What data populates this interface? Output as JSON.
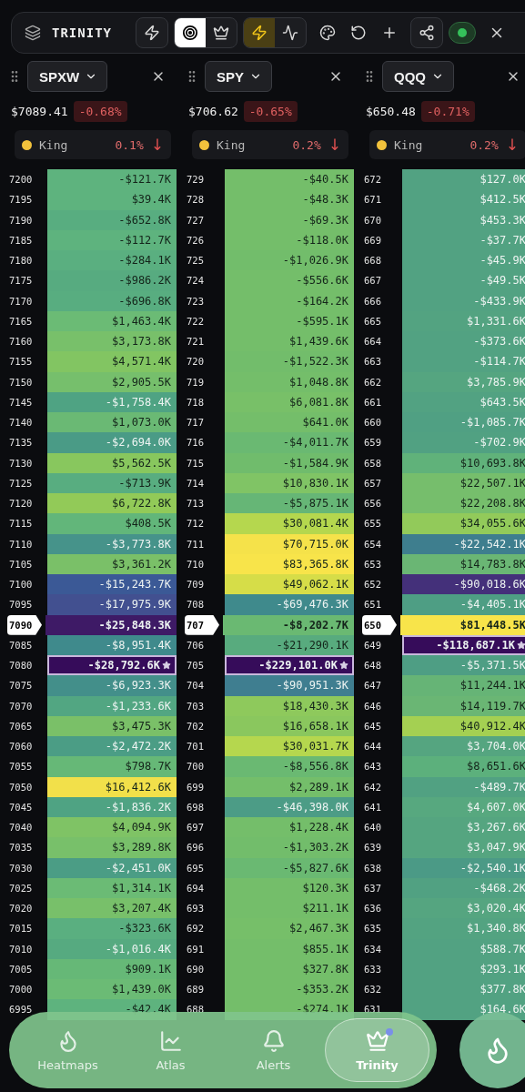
{
  "toolbar": {
    "title": "TRINITY",
    "groups": [
      {
        "boxed": true,
        "buttons": [
          {
            "kind": "bolt",
            "selected": false
          }
        ]
      },
      {
        "boxed": true,
        "buttons": [
          {
            "kind": "target",
            "selected": true
          },
          {
            "kind": "crown",
            "selected": false
          }
        ]
      },
      {
        "boxed": true,
        "buttons": [
          {
            "kind": "bolt",
            "selected": true
          },
          {
            "kind": "pulse",
            "selected": false
          }
        ]
      },
      {
        "boxed": false,
        "buttons": [
          {
            "kind": "palette",
            "selected": false
          },
          {
            "kind": "replay",
            "selected": false
          },
          {
            "kind": "plus",
            "selected": false
          }
        ]
      },
      {
        "boxed": true,
        "buttons": [
          {
            "kind": "share",
            "selected": false
          }
        ]
      }
    ],
    "live_toggle": {
      "on": true
    }
  },
  "columns": [
    {
      "ticker": "SPXW",
      "price": "$7089.41",
      "change": "-0.68%",
      "king": {
        "label": "King",
        "pct": "0.1%",
        "arrow": "↓"
      },
      "rows": [
        {
          "strike": "7200",
          "value": "-$121.7K",
          "color": "#5eb37e",
          "current": false,
          "star": false
        },
        {
          "strike": "7195",
          "value": "$39.4K",
          "color": "#5eb37e",
          "current": false,
          "star": false
        },
        {
          "strike": "7190",
          "value": "-$652.8K",
          "color": "#58ad80",
          "current": false,
          "star": false
        },
        {
          "strike": "7185",
          "value": "-$112.7K",
          "color": "#5eb37e",
          "current": false,
          "star": false
        },
        {
          "strike": "7180",
          "value": "-$284.1K",
          "color": "#5aaf80",
          "current": false,
          "star": false
        },
        {
          "strike": "7175",
          "value": "-$986.2K",
          "color": "#57ab80",
          "current": false,
          "star": false
        },
        {
          "strike": "7170",
          "value": "-$696.8K",
          "color": "#58ad80",
          "current": false,
          "star": false
        },
        {
          "strike": "7165",
          "value": "$1,463.4K",
          "color": "#6bbb75",
          "current": false,
          "star": false
        },
        {
          "strike": "7160",
          "value": "$3,173.8K",
          "color": "#78c06a",
          "current": false,
          "star": false
        },
        {
          "strike": "7155",
          "value": "$4,571.4K",
          "color": "#82c562",
          "current": false,
          "star": false
        },
        {
          "strike": "7150",
          "value": "$2,905.5K",
          "color": "#76bf6c",
          "current": false,
          "star": false
        },
        {
          "strike": "7145",
          "value": "-$1,758.4K",
          "color": "#4fa383",
          "current": false,
          "star": false
        },
        {
          "strike": "7140",
          "value": "$1,073.0K",
          "color": "#6ab974",
          "current": false,
          "star": false
        },
        {
          "strike": "7135",
          "value": "-$2,694.0K",
          "color": "#4a9b86",
          "current": false,
          "star": false
        },
        {
          "strike": "7130",
          "value": "$5,562.5K",
          "color": "#88c75e",
          "current": false,
          "star": false
        },
        {
          "strike": "7125",
          "value": "-$713.9K",
          "color": "#58ad80",
          "current": false,
          "star": false
        },
        {
          "strike": "7120",
          "value": "$6,722.8K",
          "color": "#92ca58",
          "current": false,
          "star": false
        },
        {
          "strike": "7115",
          "value": "$408.5K",
          "color": "#62b67a",
          "current": false,
          "star": false
        },
        {
          "strike": "7110",
          "value": "-$3,773.8K",
          "color": "#46938a",
          "current": false,
          "star": false
        },
        {
          "strike": "7105",
          "value": "$3,361.2K",
          "color": "#7ac068",
          "current": false,
          "star": false
        },
        {
          "strike": "7100",
          "value": "-$15,243.7K",
          "color": "#3b5996",
          "current": false,
          "star": false
        },
        {
          "strike": "7095",
          "value": "-$17,975.9K",
          "color": "#425090",
          "current": false,
          "star": false
        },
        {
          "strike": "7090",
          "value": "-$25,848.3K",
          "color": "#3e1a66",
          "current": true,
          "star": false
        },
        {
          "strike": "7085",
          "value": "-$8,951.4K",
          "color": "#3f8a8c",
          "current": false,
          "star": false
        },
        {
          "strike": "7080",
          "value": "-$28,792.6K",
          "color": "#360c5a",
          "current": false,
          "star": true
        },
        {
          "strike": "7075",
          "value": "-$6,923.3K",
          "color": "#438f8a",
          "current": false,
          "star": false
        },
        {
          "strike": "7070",
          "value": "-$1,233.6K",
          "color": "#52a682",
          "current": false,
          "star": false
        },
        {
          "strike": "7065",
          "value": "$3,475.3K",
          "color": "#7ac068",
          "current": false,
          "star": false
        },
        {
          "strike": "7060",
          "value": "-$2,472.2K",
          "color": "#4b9d85",
          "current": false,
          "star": false
        },
        {
          "strike": "7055",
          "value": "$798.7K",
          "color": "#66b877",
          "current": false,
          "star": false
        },
        {
          "strike": "7050",
          "value": "$16,412.6K",
          "color": "#f2e04a",
          "current": false,
          "star": false
        },
        {
          "strike": "7045",
          "value": "-$1,836.2K",
          "color": "#4fa383",
          "current": false,
          "star": false
        },
        {
          "strike": "7040",
          "value": "$4,094.9K",
          "color": "#7fc365",
          "current": false,
          "star": false
        },
        {
          "strike": "7035",
          "value": "$3,289.8K",
          "color": "#78c06a",
          "current": false,
          "star": false
        },
        {
          "strike": "7030",
          "value": "-$2,451.0K",
          "color": "#4b9d85",
          "current": false,
          "star": false
        },
        {
          "strike": "7025",
          "value": "$1,314.1K",
          "color": "#6bbb75",
          "current": false,
          "star": false
        },
        {
          "strike": "7020",
          "value": "$3,207.4K",
          "color": "#78c06a",
          "current": false,
          "star": false
        },
        {
          "strike": "7015",
          "value": "-$323.6K",
          "color": "#5aaf80",
          "current": false,
          "star": false
        },
        {
          "strike": "7010",
          "value": "-$1,016.4K",
          "color": "#56aa80",
          "current": false,
          "star": false
        },
        {
          "strike": "7005",
          "value": "$909.1K",
          "color": "#66b877",
          "current": false,
          "star": false
        },
        {
          "strike": "7000",
          "value": "$1,439.0K",
          "color": "#6bbb75",
          "current": false,
          "star": false
        },
        {
          "strike": "6995",
          "value": "-$42.4K",
          "color": "#5eb37e",
          "current": false,
          "star": false
        }
      ]
    },
    {
      "ticker": "SPY",
      "price": "$706.62",
      "change": "-0.65%",
      "king": {
        "label": "King",
        "pct": "0.2%",
        "arrow": "↓"
      },
      "rows": [
        {
          "strike": "729",
          "value": "-$40.5K",
          "color": "#74be6a",
          "current": false,
          "star": false
        },
        {
          "strike": "728",
          "value": "-$48.3K",
          "color": "#74be6a",
          "current": false,
          "star": false
        },
        {
          "strike": "727",
          "value": "-$69.3K",
          "color": "#74be6a",
          "current": false,
          "star": false
        },
        {
          "strike": "726",
          "value": "-$118.0K",
          "color": "#74be6a",
          "current": false,
          "star": false
        },
        {
          "strike": "725",
          "value": "-$1,026.9K",
          "color": "#72bd6b",
          "current": false,
          "star": false
        },
        {
          "strike": "724",
          "value": "-$556.6K",
          "color": "#74be6a",
          "current": false,
          "star": false
        },
        {
          "strike": "723",
          "value": "-$164.2K",
          "color": "#74be6a",
          "current": false,
          "star": false
        },
        {
          "strike": "722",
          "value": "-$595.1K",
          "color": "#74be6a",
          "current": false,
          "star": false
        },
        {
          "strike": "721",
          "value": "$1,439.6K",
          "color": "#74be6a",
          "current": false,
          "star": false
        },
        {
          "strike": "720",
          "value": "-$1,522.3K",
          "color": "#72bd6b",
          "current": false,
          "star": false
        },
        {
          "strike": "719",
          "value": "$1,048.8K",
          "color": "#74be6a",
          "current": false,
          "star": false
        },
        {
          "strike": "718",
          "value": "$6,081.8K",
          "color": "#78c068",
          "current": false,
          "star": false
        },
        {
          "strike": "717",
          "value": "$641.0K",
          "color": "#74be6a",
          "current": false,
          "star": false
        },
        {
          "strike": "716",
          "value": "-$4,011.7K",
          "color": "#6ab972",
          "current": false,
          "star": false
        },
        {
          "strike": "715",
          "value": "-$1,584.9K",
          "color": "#70bc6c",
          "current": false,
          "star": false
        },
        {
          "strike": "714",
          "value": "$10,830.1K",
          "color": "#80c465",
          "current": false,
          "star": false
        },
        {
          "strike": "713",
          "value": "-$5,875.1K",
          "color": "#66b676",
          "current": false,
          "star": false
        },
        {
          "strike": "712",
          "value": "$30,081.4K",
          "color": "#b5d74e",
          "current": false,
          "star": false
        },
        {
          "strike": "711",
          "value": "$70,715.0K",
          "color": "#f5e24a",
          "current": false,
          "star": false
        },
        {
          "strike": "710",
          "value": "$83,365.8K",
          "color": "#f8e44a",
          "current": false,
          "star": false
        },
        {
          "strike": "709",
          "value": "$49,062.1K",
          "color": "#d6dd48",
          "current": false,
          "star": false
        },
        {
          "strike": "708",
          "value": "-$69,476.3K",
          "color": "#3f8a8c",
          "current": false,
          "star": false
        },
        {
          "strike": "707",
          "value": "-$8,202.7K",
          "color": "#6ab972",
          "current": true,
          "star": false
        },
        {
          "strike": "706",
          "value": "-$21,290.1K",
          "color": "#58ab7e",
          "current": false,
          "star": false
        },
        {
          "strike": "705",
          "value": "-$229,101.0K",
          "color": "#360c5a",
          "current": false,
          "star": true
        },
        {
          "strike": "704",
          "value": "-$90,951.3K",
          "color": "#3f7e90",
          "current": false,
          "star": false
        },
        {
          "strike": "703",
          "value": "$18,430.3K",
          "color": "#8ec95c",
          "current": false,
          "star": false
        },
        {
          "strike": "702",
          "value": "$16,658.1K",
          "color": "#8ac75e",
          "current": false,
          "star": false
        },
        {
          "strike": "701",
          "value": "$30,031.7K",
          "color": "#b5d74e",
          "current": false,
          "star": false
        },
        {
          "strike": "700",
          "value": "-$8,556.8K",
          "color": "#6ab972",
          "current": false,
          "star": false
        },
        {
          "strike": "699",
          "value": "$2,289.1K",
          "color": "#74be6a",
          "current": false,
          "star": false
        },
        {
          "strike": "698",
          "value": "-$46,398.0K",
          "color": "#4c9c86",
          "current": false,
          "star": false
        },
        {
          "strike": "697",
          "value": "$1,228.4K",
          "color": "#74be6a",
          "current": false,
          "star": false
        },
        {
          "strike": "696",
          "value": "-$1,303.2K",
          "color": "#72bd6b",
          "current": false,
          "star": false
        },
        {
          "strike": "695",
          "value": "-$5,827.6K",
          "color": "#6ab972",
          "current": false,
          "star": false
        },
        {
          "strike": "694",
          "value": "$120.3K",
          "color": "#74be6a",
          "current": false,
          "star": false
        },
        {
          "strike": "693",
          "value": "$211.1K",
          "color": "#74be6a",
          "current": false,
          "star": false
        },
        {
          "strike": "692",
          "value": "$2,467.3K",
          "color": "#76bf69",
          "current": false,
          "star": false
        },
        {
          "strike": "691",
          "value": "$855.1K",
          "color": "#74be6a",
          "current": false,
          "star": false
        },
        {
          "strike": "690",
          "value": "$327.8K",
          "color": "#74be6a",
          "current": false,
          "star": false
        },
        {
          "strike": "689",
          "value": "-$353.2K",
          "color": "#74be6a",
          "current": false,
          "star": false
        },
        {
          "strike": "688",
          "value": "-$274.1K",
          "color": "#74be6a",
          "current": false,
          "star": false
        }
      ]
    },
    {
      "ticker": "QQQ",
      "price": "$650.48",
      "change": "-0.71%",
      "king": {
        "label": "King",
        "pct": "0.2%",
        "arrow": "↓"
      },
      "rows": [
        {
          "strike": "672",
          "value": "$127.0K",
          "color": "#52a282",
          "current": false,
          "star": false
        },
        {
          "strike": "671",
          "value": "$412.5K",
          "color": "#52a282",
          "current": false,
          "star": false
        },
        {
          "strike": "670",
          "value": "$453.3K",
          "color": "#52a282",
          "current": false,
          "star": false
        },
        {
          "strike": "669",
          "value": "-$37.7K",
          "color": "#52a282",
          "current": false,
          "star": false
        },
        {
          "strike": "668",
          "value": "-$45.9K",
          "color": "#52a282",
          "current": false,
          "star": false
        },
        {
          "strike": "667",
          "value": "-$49.5K",
          "color": "#52a282",
          "current": false,
          "star": false
        },
        {
          "strike": "666",
          "value": "-$433.9K",
          "color": "#52a282",
          "current": false,
          "star": false
        },
        {
          "strike": "665",
          "value": "$1,331.6K",
          "color": "#53a381",
          "current": false,
          "star": false
        },
        {
          "strike": "664",
          "value": "-$373.6K",
          "color": "#52a282",
          "current": false,
          "star": false
        },
        {
          "strike": "663",
          "value": "-$114.7K",
          "color": "#52a282",
          "current": false,
          "star": false
        },
        {
          "strike": "662",
          "value": "$3,785.9K",
          "color": "#55a580",
          "current": false,
          "star": false
        },
        {
          "strike": "661",
          "value": "$643.5K",
          "color": "#52a282",
          "current": false,
          "star": false
        },
        {
          "strike": "660",
          "value": "-$1,085.7K",
          "color": "#50a083",
          "current": false,
          "star": false
        },
        {
          "strike": "659",
          "value": "-$702.9K",
          "color": "#51a182",
          "current": false,
          "star": false
        },
        {
          "strike": "658",
          "value": "$10,693.8K",
          "color": "#60b27a",
          "current": false,
          "star": false
        },
        {
          "strike": "657",
          "value": "$22,507.1K",
          "color": "#76be6c",
          "current": false,
          "star": false
        },
        {
          "strike": "656",
          "value": "$22,208.8K",
          "color": "#76be6c",
          "current": false,
          "star": false
        },
        {
          "strike": "655",
          "value": "$34,055.6K",
          "color": "#92ca5a",
          "current": false,
          "star": false
        },
        {
          "strike": "654",
          "value": "-$22,542.1K",
          "color": "#3e7e8e",
          "current": false,
          "star": false
        },
        {
          "strike": "653",
          "value": "$14,783.8K",
          "color": "#6ab674",
          "current": false,
          "star": false
        },
        {
          "strike": "652",
          "value": "-$90,018.6K",
          "color": "#44307a",
          "current": false,
          "star": false
        },
        {
          "strike": "651",
          "value": "-$4,405.1K",
          "color": "#4e9e84",
          "current": false,
          "star": false
        },
        {
          "strike": "650",
          "value": "$81,448.5K",
          "color": "#f8e44a",
          "current": true,
          "star": false
        },
        {
          "strike": "649",
          "value": "-$118,687.1K",
          "color": "#360c5a",
          "current": false,
          "star": true
        },
        {
          "strike": "648",
          "value": "-$5,371.5K",
          "color": "#4e9e84",
          "current": false,
          "star": false
        },
        {
          "strike": "647",
          "value": "$11,244.1K",
          "color": "#66b476",
          "current": false,
          "star": false
        },
        {
          "strike": "646",
          "value": "$14,119.7K",
          "color": "#6ab674",
          "current": false,
          "star": false
        },
        {
          "strike": "645",
          "value": "$40,912.4K",
          "color": "#a4d052",
          "current": false,
          "star": false
        },
        {
          "strike": "644",
          "value": "$3,704.0K",
          "color": "#55a580",
          "current": false,
          "star": false
        },
        {
          "strike": "643",
          "value": "$8,651.6K",
          "color": "#5cb07c",
          "current": false,
          "star": false
        },
        {
          "strike": "642",
          "value": "-$489.7K",
          "color": "#51a182",
          "current": false,
          "star": false
        },
        {
          "strike": "641",
          "value": "$4,607.0K",
          "color": "#57a87f",
          "current": false,
          "star": false
        },
        {
          "strike": "640",
          "value": "$3,267.6K",
          "color": "#55a580",
          "current": false,
          "star": false
        },
        {
          "strike": "639",
          "value": "$3,047.9K",
          "color": "#55a580",
          "current": false,
          "star": false
        },
        {
          "strike": "638",
          "value": "-$2,540.1K",
          "color": "#4b9a86",
          "current": false,
          "star": false
        },
        {
          "strike": "637",
          "value": "-$468.2K",
          "color": "#51a182",
          "current": false,
          "star": false
        },
        {
          "strike": "636",
          "value": "$3,020.4K",
          "color": "#55a580",
          "current": false,
          "star": false
        },
        {
          "strike": "635",
          "value": "$1,340.8K",
          "color": "#53a381",
          "current": false,
          "star": false
        },
        {
          "strike": "634",
          "value": "$588.7K",
          "color": "#52a282",
          "current": false,
          "star": false
        },
        {
          "strike": "633",
          "value": "$293.1K",
          "color": "#52a282",
          "current": false,
          "star": false
        },
        {
          "strike": "632",
          "value": "$377.8K",
          "color": "#52a282",
          "current": false,
          "star": false
        },
        {
          "strike": "631",
          "value": "$164.6K",
          "color": "#52a282",
          "current": false,
          "star": false
        }
      ]
    }
  ],
  "nav": {
    "items": [
      {
        "kind": "flame",
        "label": "Heatmaps",
        "selected": false
      },
      {
        "kind": "chart",
        "label": "Atlas",
        "selected": false
      },
      {
        "kind": "bell",
        "label": "Alerts",
        "selected": false
      },
      {
        "kind": "crown",
        "label": "Trinity",
        "selected": true
      }
    ],
    "action": {
      "kind": "flame"
    }
  }
}
